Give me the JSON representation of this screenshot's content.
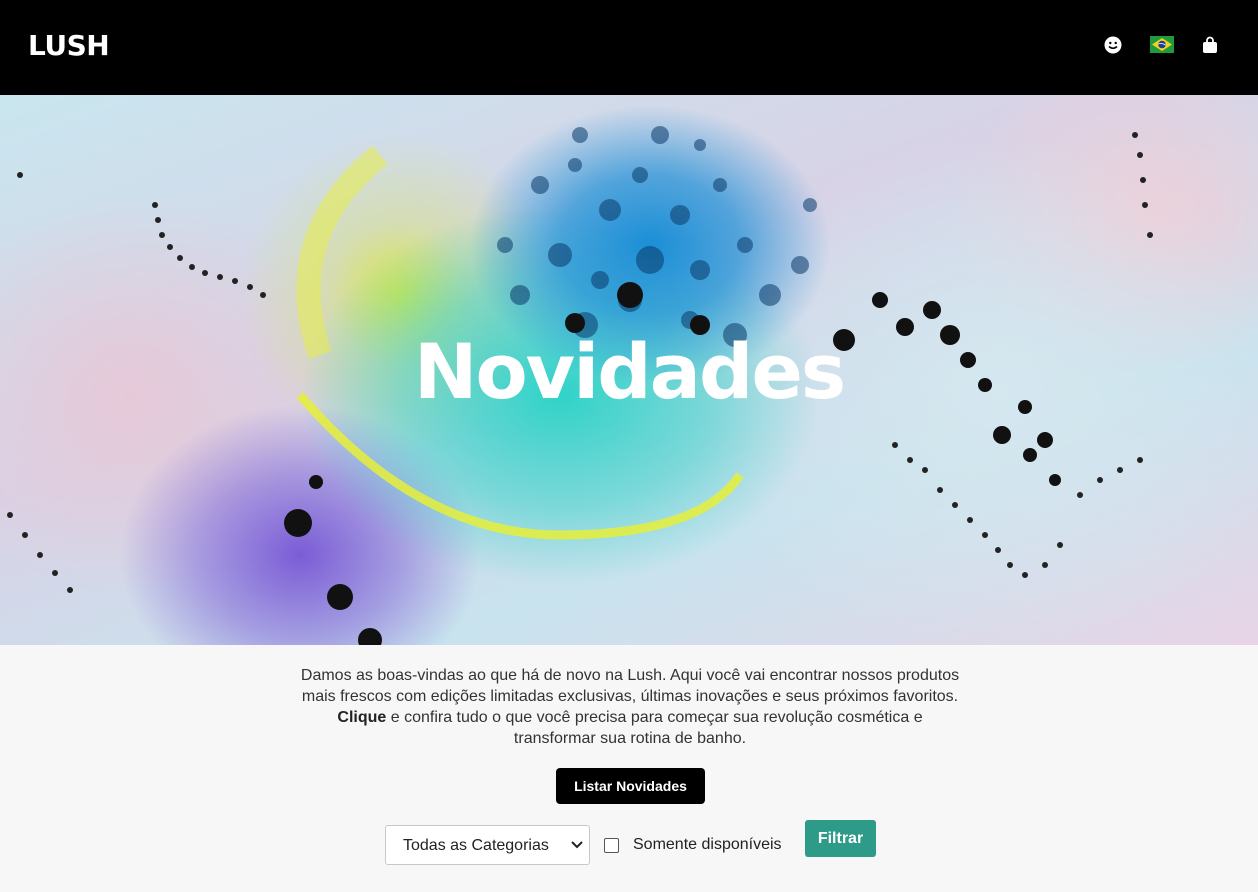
{
  "header": {
    "logo": "LUSH",
    "icons": [
      "account-icon",
      "brazil-flag-icon",
      "shopping-bag-icon"
    ],
    "background": "#000000"
  },
  "hero": {
    "title": "Novidades"
  },
  "intro": {
    "text_before": "Damos as boas-vindas ao que há de novo na Lush. Aqui você vai encontrar nossos produtos mais frescos com edições limitadas exclusivas, últimas inovações e seus próximos favoritos. ",
    "bold": "Clique",
    "text_after": " e confira tudo o que você precisa para começar sua revolução cosmética e transformar sua rotina de banho."
  },
  "actions": {
    "list_button": "Listar Novidades"
  },
  "filters": {
    "category_selected": "Todas as Categorias",
    "available_only_label": "Somente disponíveis",
    "available_only_checked": false,
    "filter_button": "Filtrar",
    "filter_button_color": "#2e9a88"
  }
}
